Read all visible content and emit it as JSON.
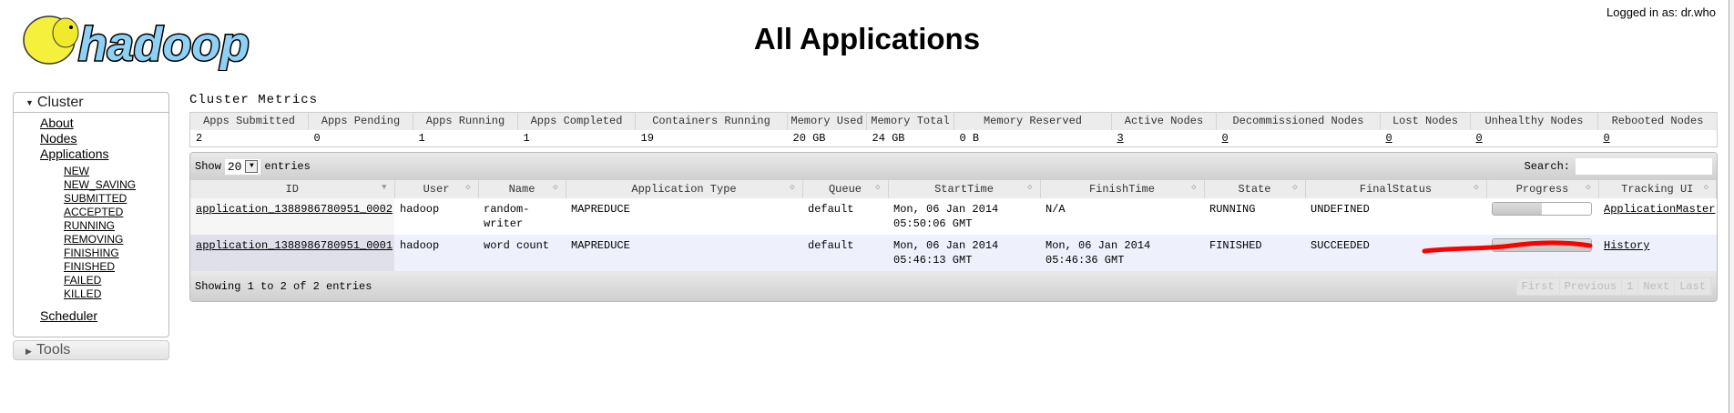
{
  "header": {
    "logo_text": "hadoop",
    "title": "All Applications",
    "logged_in": "Logged in as: dr.who"
  },
  "sidebar": {
    "cluster": "Cluster",
    "links": [
      "About",
      "Nodes",
      "Applications"
    ],
    "states": [
      "NEW",
      "NEW_SAVING",
      "SUBMITTED",
      "ACCEPTED",
      "RUNNING",
      "REMOVING",
      "FINISHING",
      "FINISHED",
      "FAILED",
      "KILLED"
    ],
    "scheduler": "Scheduler",
    "tools": "Tools"
  },
  "metrics": {
    "title": "Cluster Metrics",
    "headers": [
      "Apps Submitted",
      "Apps Pending",
      "Apps Running",
      "Apps Completed",
      "Containers Running",
      "Memory Used",
      "Memory Total",
      "Memory Reserved",
      "Active Nodes",
      "Decommissioned Nodes",
      "Lost Nodes",
      "Unhealthy Nodes",
      "Rebooted Nodes"
    ],
    "values": [
      "2",
      "0",
      "1",
      "1",
      "19",
      "20 GB",
      "24 GB",
      "0 B",
      "3",
      "0",
      "0",
      "0",
      "0"
    ]
  },
  "table": {
    "show": "Show",
    "page_size": "20",
    "entries": "entries",
    "search_label": "Search:",
    "search_value": "",
    "columns": [
      "ID",
      "User",
      "Name",
      "Application Type",
      "Queue",
      "StartTime",
      "FinishTime",
      "State",
      "FinalStatus",
      "Progress",
      "Tracking UI"
    ],
    "rows": [
      {
        "id": "application_1388986780951_0002",
        "user": "hadoop",
        "name": "random-writer",
        "type": "MAPREDUCE",
        "queue": "default",
        "start1": "Mon, 06 Jan 2014",
        "start2": "05:50:06 GMT",
        "finish1": "N/A",
        "finish2": "",
        "state": "RUNNING",
        "final": "UNDEFINED",
        "progress": 50,
        "tracking": "ApplicationMaster"
      },
      {
        "id": "application_1388986780951_0001",
        "user": "hadoop",
        "name": "word count",
        "type": "MAPREDUCE",
        "queue": "default",
        "start1": "Mon, 06 Jan 2014",
        "start2": "05:46:13 GMT",
        "finish1": "Mon, 06 Jan 2014",
        "finish2": "05:46:36 GMT",
        "state": "FINISHED",
        "final": "SUCCEEDED",
        "progress": 100,
        "tracking": "History"
      }
    ],
    "info": "Showing 1 to 2 of 2 entries",
    "pager": [
      "First",
      "Previous",
      "1",
      "Next",
      "Last"
    ]
  },
  "colors": {
    "logo_blue": "#8fd0f5",
    "elephant": "#f5f03c",
    "annotation": "#ff0000"
  }
}
